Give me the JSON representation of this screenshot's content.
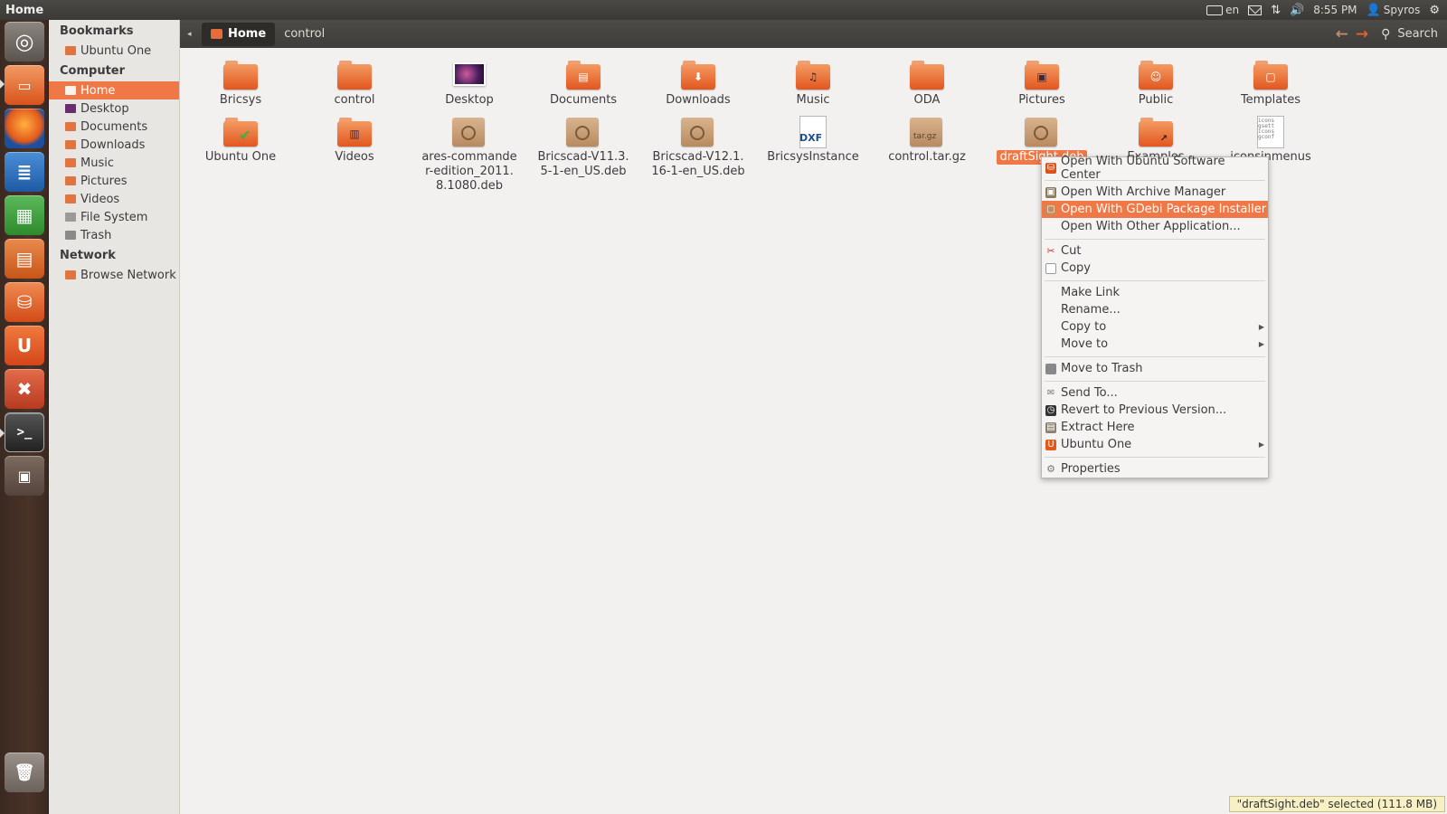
{
  "window": {
    "title": "Home"
  },
  "panel": {
    "keyboard_layout": "en",
    "time": "8:55 PM",
    "user": "Spyros"
  },
  "sidebar": {
    "bookmarks_header": "Bookmarks",
    "bookmarks": [
      {
        "label": "Ubuntu One"
      }
    ],
    "computer_header": "Computer",
    "computer": [
      {
        "label": "Home"
      },
      {
        "label": "Desktop"
      },
      {
        "label": "Documents"
      },
      {
        "label": "Downloads"
      },
      {
        "label": "Music"
      },
      {
        "label": "Pictures"
      },
      {
        "label": "Videos"
      },
      {
        "label": "File System"
      },
      {
        "label": "Trash"
      }
    ],
    "network_header": "Network",
    "network": [
      {
        "label": "Browse Network"
      }
    ]
  },
  "toolbar": {
    "breadcrumbs": [
      "Home",
      "control"
    ],
    "search_label": "Search"
  },
  "files": [
    {
      "name": "Bricsys",
      "type": "folder"
    },
    {
      "name": "control",
      "type": "folder"
    },
    {
      "name": "Desktop",
      "type": "desktop"
    },
    {
      "name": "Documents",
      "type": "folder",
      "emblem": "doc"
    },
    {
      "name": "Downloads",
      "type": "folder",
      "emblem": "down"
    },
    {
      "name": "Music",
      "type": "folder",
      "emblem": "music"
    },
    {
      "name": "ODA",
      "type": "folder"
    },
    {
      "name": "Pictures",
      "type": "folder",
      "emblem": "picture"
    },
    {
      "name": "Public",
      "type": "folder",
      "emblem": "person"
    },
    {
      "name": "Templates",
      "type": "folder",
      "emblem": "template"
    },
    {
      "name": "Ubuntu One",
      "type": "folder",
      "emblem": "check"
    },
    {
      "name": "Videos",
      "type": "folder",
      "emblem": "film"
    },
    {
      "name": "ares-commander-edition_2011.8.1080.deb",
      "type": "package"
    },
    {
      "name": "Bricscad-V11.3.5-1-en_US.deb",
      "type": "package"
    },
    {
      "name": "Bricscad-V12.1.16-1-en_US.deb",
      "type": "package"
    },
    {
      "name": "BricsysInstance",
      "type": "dxf"
    },
    {
      "name": "control.tar.gz",
      "type": "targz"
    },
    {
      "name": "draftSight.deb",
      "type": "package",
      "selected": true
    },
    {
      "name": "Examples",
      "type": "folder",
      "emblem": "link"
    },
    {
      "name": "iconsinmenus",
      "type": "text"
    }
  ],
  "context_menu": {
    "items": [
      "Open With Ubuntu Software Center",
      "Open With Archive Manager",
      "Open With GDebi Package Installer",
      "Open With Other Application...",
      "Cut",
      "Copy",
      "Make Link",
      "Rename...",
      "Copy to",
      "Move to",
      "Move to Trash",
      "Send To...",
      "Revert to Previous Version...",
      "Extract Here",
      "Ubuntu One",
      "Properties"
    ],
    "highlighted": "Open With GDebi Package Installer"
  },
  "status_bar": {
    "text": "\"draftSight.deb\" selected (111.8 MB)"
  },
  "colors": {
    "accent": "#f07746",
    "launcher": "#4a3328"
  }
}
